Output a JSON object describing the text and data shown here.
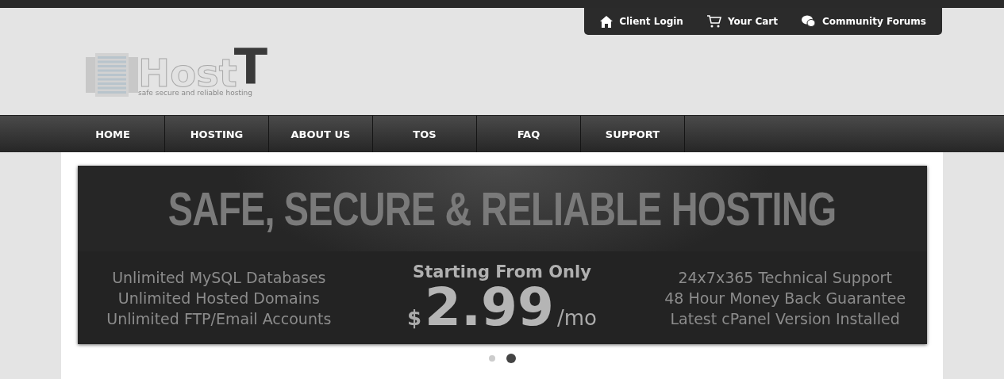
{
  "top_links": [
    {
      "label": "Client Login",
      "kind": "home"
    },
    {
      "label": "Your Cart",
      "kind": "cart"
    },
    {
      "label": "Community Forums",
      "kind": "chat"
    }
  ],
  "logo": {
    "word": "Host",
    "letter": "T",
    "tagline": "safe secure and reliable hosting"
  },
  "nav": [
    {
      "label": "HOME"
    },
    {
      "label": "HOSTING"
    },
    {
      "label": "ABOUT US"
    },
    {
      "label": "TOS"
    },
    {
      "label": "FAQ"
    },
    {
      "label": "SUPPORT"
    }
  ],
  "banner": {
    "headline": "SAFE, SECURE & RELIABLE HOSTING",
    "left_features": [
      "Unlimited MySQL Databases",
      "Unlimited Hosted Domains",
      "Unlimited FTP/Email Accounts"
    ],
    "price_label": "Starting From Only",
    "currency": "$",
    "price": "2.99",
    "period": "/mo",
    "right_features": [
      "24x7x365 Technical Support",
      "48 Hour Money Back Guarantee",
      "Latest cPanel Version Installed"
    ]
  },
  "slider_dots": [
    {
      "selected": false
    },
    {
      "selected": true
    }
  ]
}
